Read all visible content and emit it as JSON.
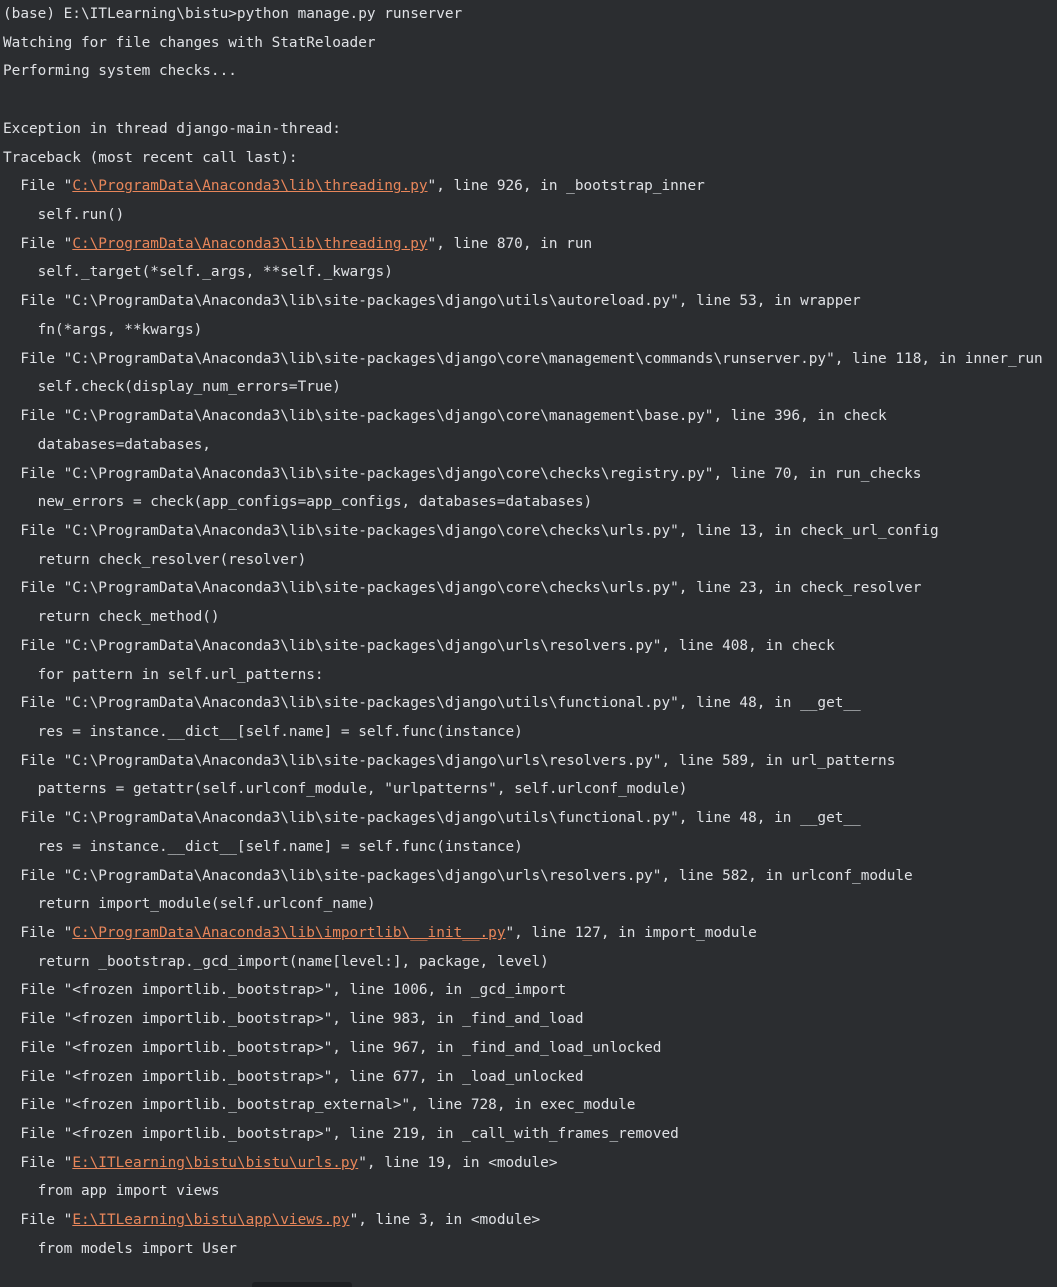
{
  "console": {
    "lines": [
      {
        "kind": "text",
        "text": "(base) E:\\ITLearning\\bistu>python manage.py runserver"
      },
      {
        "kind": "text",
        "text": "Watching for file changes with StatReloader"
      },
      {
        "kind": "text",
        "text": "Performing system checks..."
      },
      {
        "kind": "text",
        "text": ""
      },
      {
        "kind": "text",
        "text": "Exception in thread django-main-thread:"
      },
      {
        "kind": "text",
        "text": "Traceback (most recent call last):"
      },
      {
        "kind": "link",
        "pre": "  File \"",
        "link": "C:\\ProgramData\\Anaconda3\\lib\\threading.py",
        "post": "\", line 926, in _bootstrap_inner"
      },
      {
        "kind": "text",
        "text": "    self.run()"
      },
      {
        "kind": "link",
        "pre": "  File \"",
        "link": "C:\\ProgramData\\Anaconda3\\lib\\threading.py",
        "post": "\", line 870, in run"
      },
      {
        "kind": "text",
        "text": "    self._target(*self._args, **self._kwargs)"
      },
      {
        "kind": "text",
        "text": "  File \"C:\\ProgramData\\Anaconda3\\lib\\site-packages\\django\\utils\\autoreload.py\", line 53, in wrapper"
      },
      {
        "kind": "text",
        "text": "    fn(*args, **kwargs)"
      },
      {
        "kind": "text",
        "text": "  File \"C:\\ProgramData\\Anaconda3\\lib\\site-packages\\django\\core\\management\\commands\\runserver.py\", line 118, in inner_run"
      },
      {
        "kind": "text",
        "text": "    self.check(display_num_errors=True)"
      },
      {
        "kind": "text",
        "text": "  File \"C:\\ProgramData\\Anaconda3\\lib\\site-packages\\django\\core\\management\\base.py\", line 396, in check"
      },
      {
        "kind": "text",
        "text": "    databases=databases,"
      },
      {
        "kind": "text",
        "text": "  File \"C:\\ProgramData\\Anaconda3\\lib\\site-packages\\django\\core\\checks\\registry.py\", line 70, in run_checks"
      },
      {
        "kind": "text",
        "text": "    new_errors = check(app_configs=app_configs, databases=databases)"
      },
      {
        "kind": "text",
        "text": "  File \"C:\\ProgramData\\Anaconda3\\lib\\site-packages\\django\\core\\checks\\urls.py\", line 13, in check_url_config"
      },
      {
        "kind": "text",
        "text": "    return check_resolver(resolver)"
      },
      {
        "kind": "text",
        "text": "  File \"C:\\ProgramData\\Anaconda3\\lib\\site-packages\\django\\core\\checks\\urls.py\", line 23, in check_resolver"
      },
      {
        "kind": "text",
        "text": "    return check_method()"
      },
      {
        "kind": "text",
        "text": "  File \"C:\\ProgramData\\Anaconda3\\lib\\site-packages\\django\\urls\\resolvers.py\", line 408, in check"
      },
      {
        "kind": "text",
        "text": "    for pattern in self.url_patterns:"
      },
      {
        "kind": "text",
        "text": "  File \"C:\\ProgramData\\Anaconda3\\lib\\site-packages\\django\\utils\\functional.py\", line 48, in __get__"
      },
      {
        "kind": "text",
        "text": "    res = instance.__dict__[self.name] = self.func(instance)"
      },
      {
        "kind": "text",
        "text": "  File \"C:\\ProgramData\\Anaconda3\\lib\\site-packages\\django\\urls\\resolvers.py\", line 589, in url_patterns"
      },
      {
        "kind": "text",
        "text": "    patterns = getattr(self.urlconf_module, \"urlpatterns\", self.urlconf_module)"
      },
      {
        "kind": "text",
        "text": "  File \"C:\\ProgramData\\Anaconda3\\lib\\site-packages\\django\\utils\\functional.py\", line 48, in __get__"
      },
      {
        "kind": "text",
        "text": "    res = instance.__dict__[self.name] = self.func(instance)"
      },
      {
        "kind": "text",
        "text": "  File \"C:\\ProgramData\\Anaconda3\\lib\\site-packages\\django\\urls\\resolvers.py\", line 582, in urlconf_module"
      },
      {
        "kind": "text",
        "text": "    return import_module(self.urlconf_name)"
      },
      {
        "kind": "link",
        "pre": "  File \"",
        "link": "C:\\ProgramData\\Anaconda3\\lib\\importlib\\__init__.py",
        "post": "\", line 127, in import_module"
      },
      {
        "kind": "text",
        "text": "    return _bootstrap._gcd_import(name[level:], package, level)"
      },
      {
        "kind": "text",
        "text": "  File \"<frozen importlib._bootstrap>\", line 1006, in _gcd_import"
      },
      {
        "kind": "text",
        "text": "  File \"<frozen importlib._bootstrap>\", line 983, in _find_and_load"
      },
      {
        "kind": "text",
        "text": "  File \"<frozen importlib._bootstrap>\", line 967, in _find_and_load_unlocked"
      },
      {
        "kind": "text",
        "text": "  File \"<frozen importlib._bootstrap>\", line 677, in _load_unlocked"
      },
      {
        "kind": "text",
        "text": "  File \"<frozen importlib._bootstrap_external>\", line 728, in exec_module"
      },
      {
        "kind": "text",
        "text": "  File \"<frozen importlib._bootstrap>\", line 219, in _call_with_frames_removed"
      },
      {
        "kind": "link",
        "pre": "  File \"",
        "link": "E:\\ITLearning\\bistu\\bistu\\urls.py",
        "post": "\", line 19, in <module>"
      },
      {
        "kind": "text",
        "text": "    from app import views"
      },
      {
        "kind": "link",
        "pre": "  File \"",
        "link": "E:\\ITLearning\\bistu\\app\\views.py",
        "post": "\", line 3, in <module>"
      },
      {
        "kind": "text",
        "text": "    from models import User"
      }
    ]
  },
  "colors": {
    "background": "#2b2d30",
    "text": "#dfe1e5",
    "file_link": "#e8865a"
  }
}
